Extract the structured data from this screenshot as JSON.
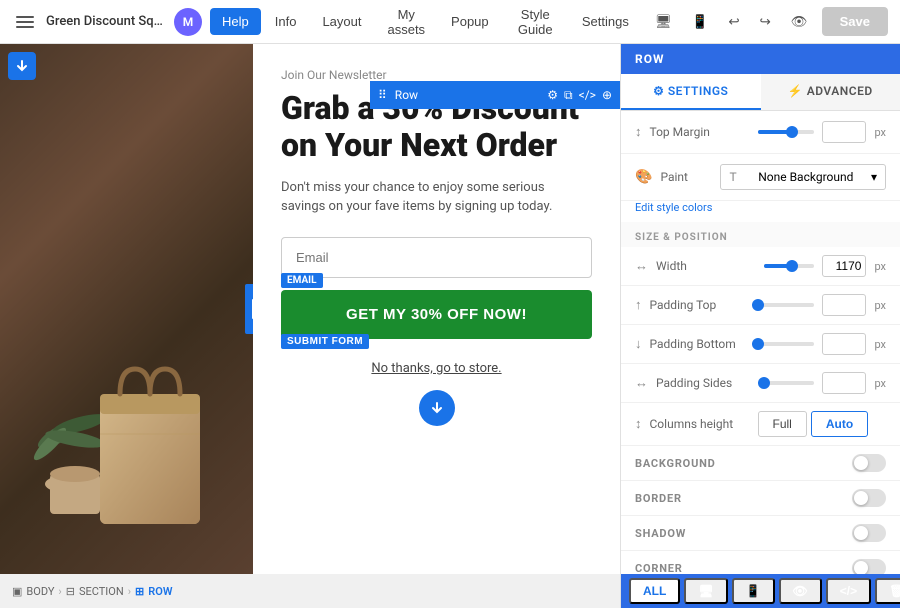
{
  "topbar": {
    "site_name": "Green Discount Squee...",
    "avatar_initial": "M",
    "nav_items": [
      {
        "label": "Help",
        "active": true
      },
      {
        "label": "Info",
        "active": false
      },
      {
        "label": "Layout",
        "active": false
      },
      {
        "label": "My assets",
        "active": false
      },
      {
        "label": "Popup",
        "active": false
      },
      {
        "label": "Style Guide",
        "active": false
      },
      {
        "label": "Settings",
        "active": false
      }
    ],
    "save_label": "Save",
    "undo_icon": "↩",
    "redo_icon": "↪",
    "preview_icon": "👁"
  },
  "canvas": {
    "row_label": "Row",
    "headline": "Grab a 30% Discount on Your Next Order",
    "newsletter_label": "Join Our Newsletter",
    "subtext": "Don't miss your chance to enjoy some serious savings on your fave items by signing up today.",
    "email_placeholder": "Email",
    "email_badge": "EMAIL",
    "cta_label": "GET MY 30% OFF NOW!",
    "submit_badge": "SUBMIT FORM",
    "no_thanks": "No thanks, go to store."
  },
  "right_panel": {
    "header_label": "ROW",
    "tabs": [
      {
        "label": "SETTINGS",
        "active": true
      },
      {
        "label": "ADVANCED",
        "active": false
      }
    ],
    "top_margin_label": "Top Margin",
    "paint_label": "Paint",
    "paint_value": "None Background",
    "edit_style_label": "Edit style colors",
    "size_position_header": "SIZE & POSITION",
    "width_label": "Width",
    "width_value": "1170",
    "width_slider_pct": 55,
    "padding_top_label": "Padding Top",
    "padding_bottom_label": "Padding Bottom",
    "padding_sides_label": "Padding Sides",
    "columns_height_label": "Columns height",
    "col_height_full": "Full",
    "col_height_auto": "Auto",
    "background_label": "BACKGROUND",
    "border_label": "BORDER",
    "shadow_label": "SHADOW",
    "corner_label": "CORNER"
  },
  "bottom": {
    "breadcrumbs": [
      {
        "label": "BODY",
        "icon": "▣"
      },
      {
        "label": "SECTION",
        "icon": "⊟"
      },
      {
        "label": "ROW",
        "icon": "⊞",
        "active": true
      }
    ],
    "tabs": [
      {
        "label": "ALL",
        "active": true
      },
      {
        "label": "🖥",
        "active": false
      },
      {
        "label": "📱",
        "active": false
      },
      {
        "label": "👁",
        "active": false
      },
      {
        "label": "</>",
        "active": false
      },
      {
        "label": "🗑",
        "active": false
      }
    ]
  }
}
